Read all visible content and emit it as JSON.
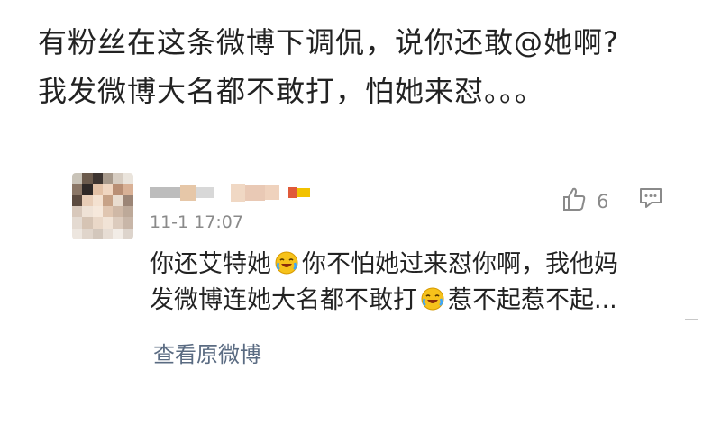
{
  "caption": {
    "line1": "有粉丝在这条微博下调侃，说你还敢@她啊?",
    "line2": "我发微博大名都不敢打，怕她来怼。。。"
  },
  "comment": {
    "avatar_icon": "blurred-avatar",
    "username_icon": "blurred-username",
    "timestamp": "11-1 17:07",
    "like_count": "6",
    "like_icon": "thumbs-up-icon",
    "comment_icon": "comment-icon",
    "text_part1": "你还艾特她",
    "text_part2": "你不怕她过来怼你啊，我他妈",
    "text_part3": "发微博连她大名都不敢打",
    "text_part4": "惹不起惹不起...",
    "emoji_icon": "laughing-crying-emoji",
    "view_original": "查看原微博"
  },
  "colors": {
    "link": "#5a6b82",
    "muted": "#8a8a8a",
    "text": "#222222"
  }
}
